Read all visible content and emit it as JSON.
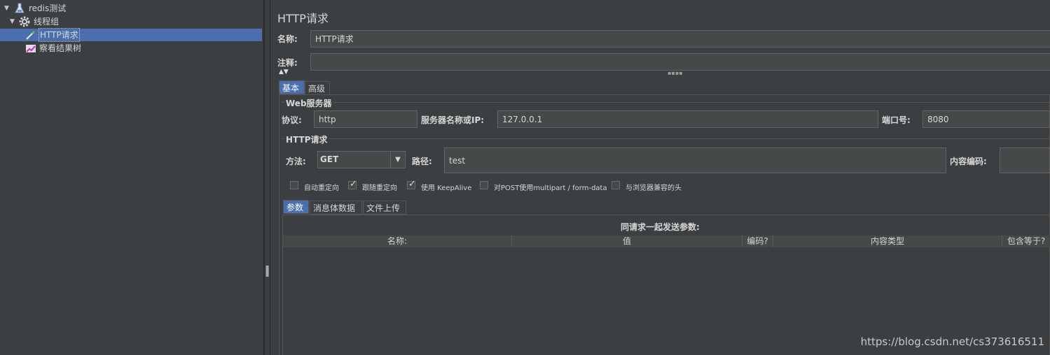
{
  "tree": {
    "items": [
      {
        "label": "redis测试",
        "icon": "test-plan-icon",
        "expanded": true
      },
      {
        "label": "线程组",
        "icon": "gear-icon",
        "expanded": true
      },
      {
        "label": "HTTP请求",
        "icon": "pipette-icon",
        "selected": true
      },
      {
        "label": "察看结果树",
        "icon": "chart-icon"
      }
    ]
  },
  "panel": {
    "title": "HTTP请求",
    "name_label": "名称:",
    "name_value": "HTTP请求",
    "comment_label": "注释:",
    "comment_value": ""
  },
  "tabs": [
    {
      "label": "基本",
      "active": true
    },
    {
      "label": "高级",
      "active": false
    }
  ],
  "web_server": {
    "title": "Web服务器",
    "protocol_label": "协议:",
    "protocol_value": "http",
    "server_label": "服务器名称或IP:",
    "server_value": "127.0.0.1",
    "port_label": "端口号:",
    "port_value": "8080"
  },
  "http_request": {
    "title": "HTTP请求",
    "method_label": "方法:",
    "method_value": "GET",
    "path_label": "路径:",
    "path_value": "test",
    "encoding_label": "内容编码:",
    "encoding_value": ""
  },
  "options": [
    {
      "label": "自动重定向",
      "checked": false
    },
    {
      "label": "跟随重定向",
      "checked": true
    },
    {
      "label": "使用 KeepAlive",
      "checked": true
    },
    {
      "label": "对POST使用multipart / form-data",
      "checked": false
    },
    {
      "label": "与浏览器兼容的头",
      "checked": false
    }
  ],
  "sub_tabs": [
    {
      "label": "参数",
      "active": true
    },
    {
      "label": "消息体数据",
      "active": false
    },
    {
      "label": "文件上传",
      "active": false
    }
  ],
  "params": {
    "caption": "同请求一起发送参数:",
    "columns": [
      "名称:",
      "值",
      "编码?",
      "内容类型",
      "包含等于?"
    ]
  },
  "watermark": "https://blog.csdn.net/cs373616511",
  "colors": {
    "background": "#3c3f41",
    "selection": "#4b6eaf",
    "field": "#45494a"
  }
}
